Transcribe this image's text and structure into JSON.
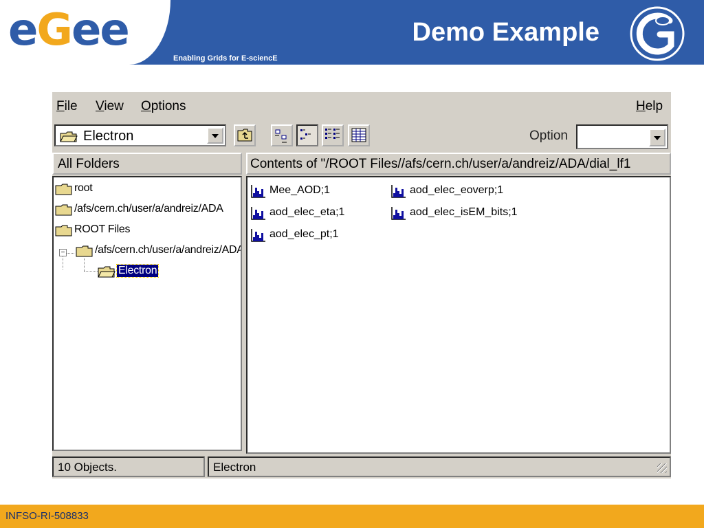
{
  "slide": {
    "logo": {
      "letters": [
        "e",
        "G",
        "e",
        "e"
      ]
    },
    "tagline": "Enabling Grids for E-sciencE",
    "title": "Demo Example",
    "footer": "INFSO-RI-508833",
    "colors": {
      "blue": "#2f5ca8",
      "orange": "#f2a81d"
    }
  },
  "app": {
    "menu": {
      "file": {
        "accel": "F",
        "rest": "ile"
      },
      "view": {
        "accel": "V",
        "rest": "iew"
      },
      "options": {
        "accel": "O",
        "rest": "ptions"
      },
      "help": {
        "accel": "H",
        "rest": "elp"
      }
    },
    "toolbar": {
      "location_value": "Electron",
      "option_label": "Option",
      "option_value": "",
      "buttons": [
        "up-folder-icon",
        "large-icons-view-icon",
        "small-icons-view-icon",
        "list-view-icon",
        "details-view-icon"
      ]
    },
    "left_header": "All Folders",
    "right_header": "Contents of \"/ROOT Files//afs/cern.ch/user/a/andreiz/ADA/dial_lf1",
    "tree": [
      {
        "label": "root"
      },
      {
        "label": "/afs/cern.ch/user/a/andreiz/ADA"
      },
      {
        "label": "ROOT Files"
      },
      {
        "label": "/afs/cern.ch/user/a/andreiz/ADA"
      },
      {
        "label": "Electron",
        "selected": true
      }
    ],
    "files": [
      {
        "label": "Mee_AOD;1"
      },
      {
        "label": "aod_elec_eoverp;1"
      },
      {
        "label": "aod_elec_eta;1"
      },
      {
        "label": "aod_elec_isEM_bits;1"
      },
      {
        "label": "aod_elec_pt;1"
      }
    ],
    "status": {
      "count": "10 Objects.",
      "path": "Electron"
    }
  }
}
